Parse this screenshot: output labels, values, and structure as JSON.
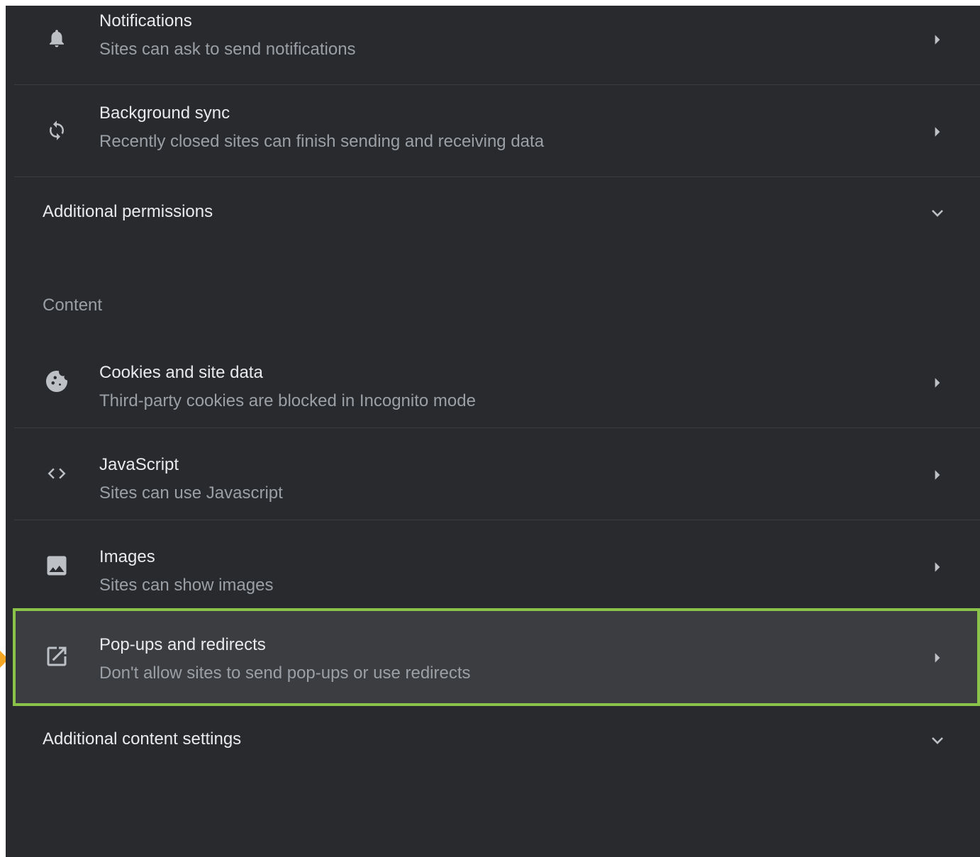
{
  "colors": {
    "background": "#292a2d",
    "divider": "#3c3d40",
    "title_text": "#e8eaed",
    "secondary_text": "#9aa0a6",
    "icon": "#bdc1c6",
    "highlight_background": "#3c3d40",
    "highlight_border": "#8bc34a",
    "pointer_marker": "#f5a623"
  },
  "permissions": {
    "items": [
      {
        "title": "Notifications",
        "subtitle": "Sites can ask to send notifications",
        "icon": "bell-icon"
      },
      {
        "title": "Background sync",
        "subtitle": "Recently closed sites can finish sending and receiving data",
        "icon": "sync-icon"
      }
    ],
    "additional_label": "Additional permissions"
  },
  "content": {
    "heading": "Content",
    "items": [
      {
        "title": "Cookies and site data",
        "subtitle": "Third-party cookies are blocked in Incognito mode",
        "icon": "cookie-icon"
      },
      {
        "title": "JavaScript",
        "subtitle": "Sites can use Javascript",
        "icon": "code-icon"
      },
      {
        "title": "Images",
        "subtitle": "Sites can show images",
        "icon": "image-icon"
      },
      {
        "title": "Pop-ups and redirects",
        "subtitle": "Don't allow sites to send pop-ups or use redirects",
        "icon": "open-in-new-icon",
        "highlighted": true
      }
    ],
    "additional_label": "Additional content settings"
  }
}
